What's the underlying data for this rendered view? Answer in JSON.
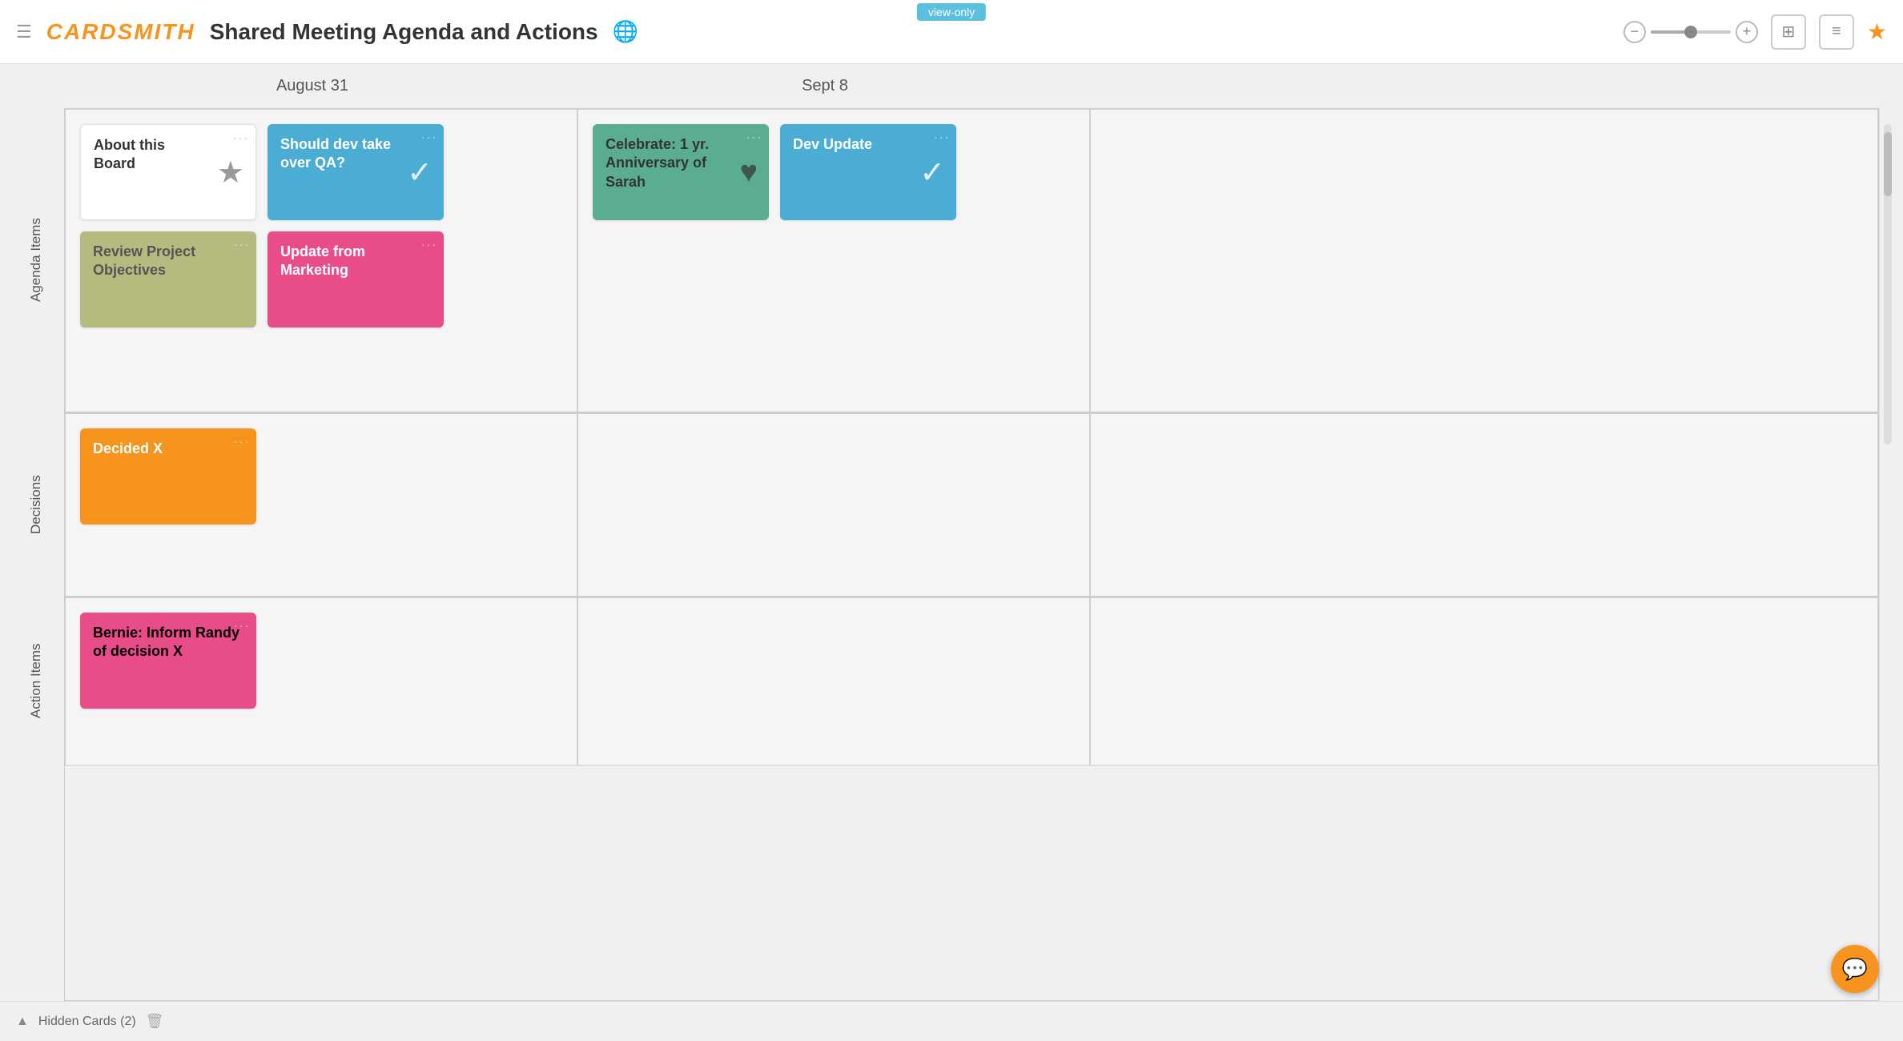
{
  "header": {
    "menu_label": "☰",
    "logo": "CARDSMITH",
    "title": "Shared Meeting Agenda and Actions",
    "view_only_badge": "view-only",
    "zoom_minus": "−",
    "zoom_plus": "+",
    "grid_icon": "⊞",
    "list_icon": "≡",
    "star_icon": "★"
  },
  "columns": [
    {
      "label": "August 31"
    },
    {
      "label": "Sept 8"
    }
  ],
  "rows": [
    {
      "label": "Agenda Items"
    },
    {
      "label": "Decisions"
    },
    {
      "label": "Action Items"
    }
  ],
  "cards": {
    "agenda_aug31": [
      {
        "id": "about-board",
        "text": "About this Board",
        "icon": "★",
        "style": "white"
      },
      {
        "id": "should-dev",
        "text": "Should dev take over QA?",
        "icon": "✓",
        "style": "blue"
      },
      {
        "id": "review-project",
        "text": "Review Project Objectives",
        "icon": "",
        "style": "olive"
      },
      {
        "id": "update-marketing",
        "text": "Update from Marketing",
        "icon": "",
        "style": "pink"
      }
    ],
    "agenda_sept8": [
      {
        "id": "celebrate",
        "text": "Celebrate: 1 yr. Anniversary of Sarah",
        "icon": "♥",
        "style": "green"
      },
      {
        "id": "dev-update",
        "text": "Dev Update",
        "icon": "✓",
        "style": "blue"
      }
    ],
    "decisions_aug31": [
      {
        "id": "decided-x",
        "text": "Decided X",
        "icon": "",
        "style": "orange"
      }
    ],
    "decisions_sept8": [],
    "action_aug31": [
      {
        "id": "bernie-inform",
        "text": "Bernie: Inform Randy of decision X",
        "icon": "",
        "style": "pink"
      }
    ],
    "action_sept8": []
  },
  "footer": {
    "arrow": "▲",
    "hidden_cards_text": "Hidden Cards (2)",
    "trash_icon": "🗑"
  },
  "chat_button": {
    "icon": "💬"
  }
}
